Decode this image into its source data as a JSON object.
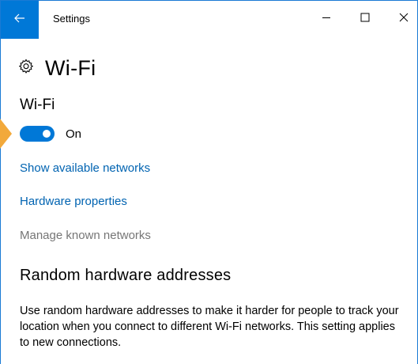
{
  "window": {
    "title": "Settings"
  },
  "icons": {
    "back": "back-arrow-icon",
    "minimize": "minimize-icon",
    "maximize": "maximize-icon",
    "close": "close-icon",
    "settings": "gear-icon"
  },
  "page": {
    "title": "Wi-Fi"
  },
  "wifi": {
    "section_title": "Wi-Fi",
    "toggle_state": "On",
    "toggle_on": true
  },
  "links": {
    "show_networks": "Show available networks",
    "hardware_properties": "Hardware properties",
    "manage_known": "Manage known networks"
  },
  "random_hw": {
    "title": "Random hardware addresses",
    "description": "Use random hardware addresses to make it harder for people to track your location when you connect to different Wi-Fi networks. This setting applies to new connections."
  },
  "colors": {
    "accent": "#0078d7",
    "link": "#0063b1",
    "disabled_text": "#767676",
    "pointer": "#f2a93b"
  }
}
